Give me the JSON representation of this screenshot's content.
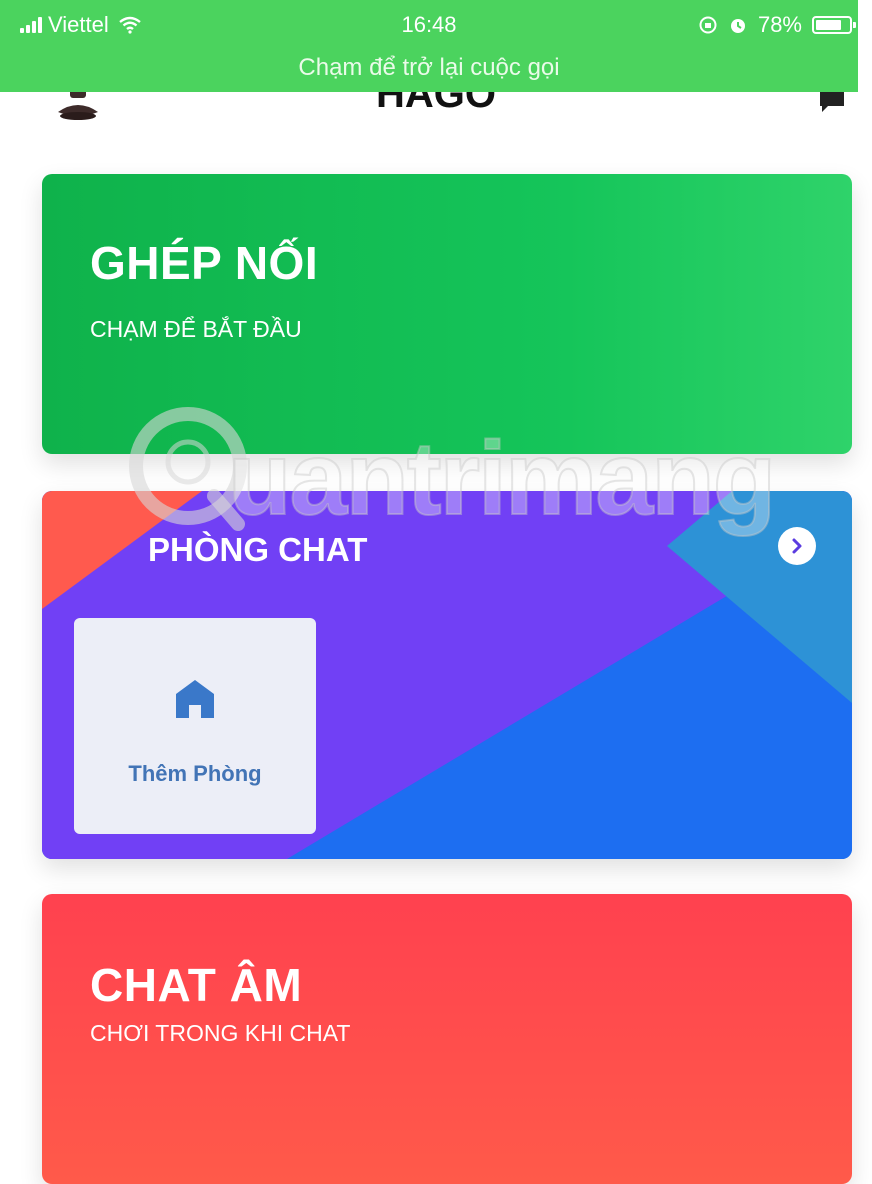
{
  "status_bar": {
    "carrier": "Viettel",
    "time": "16:48",
    "battery": "78%",
    "call_banner": "Chạm để trở lại cuộc gọi"
  },
  "header": {
    "title": "HAGO"
  },
  "cards": {
    "match": {
      "title": "GHÉP NỐI",
      "subtitle": "CHẠM ĐỂ BẮT ĐẦU"
    },
    "chat_room": {
      "title": "PHÒNG CHAT",
      "add_room_label": "Thêm Phòng"
    },
    "audio_chat": {
      "title": "CHAT ÂM",
      "subtitle": "CHƠI TRONG KHI CHAT"
    }
  },
  "watermark": "uantrimang",
  "colors": {
    "status_green": "#4bd35e",
    "match_green": "#15c55a",
    "chat_purple": "#7140f5",
    "chat_blue": "#1d6ef1",
    "audio_red": "#ff4a4e",
    "add_room_blue": "#4274b6"
  },
  "icons": [
    "signal-icon",
    "wifi-icon",
    "alarm-icon",
    "battery-icon",
    "avatar-icon",
    "chat-icon",
    "chevron-right-icon",
    "home-icon"
  ]
}
